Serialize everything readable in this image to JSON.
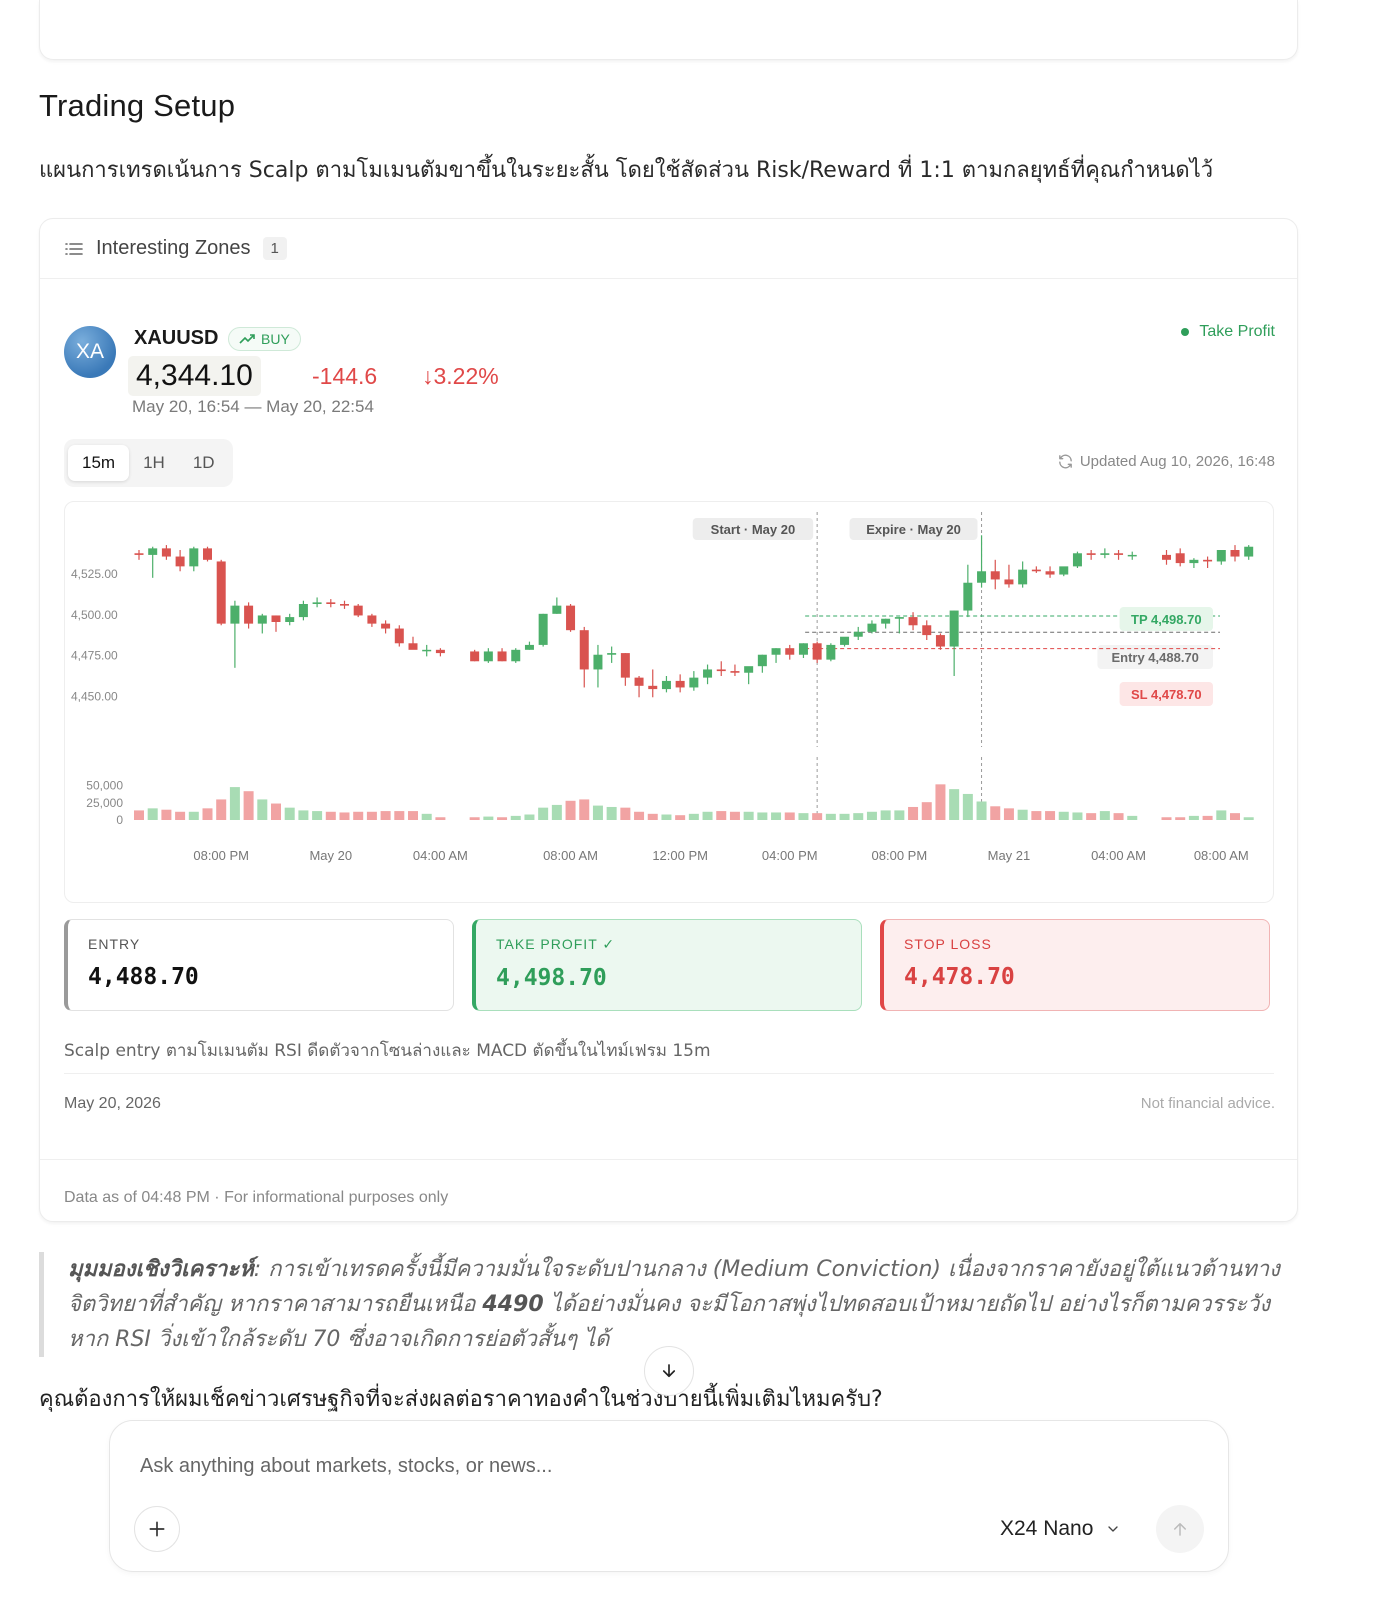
{
  "setup": {
    "title": "Trading Setup",
    "description": "แผนการเทรดเน้นการ Scalp ตามโมเมนตัมขาขึ้นในระยะสั้น โดยใช้สัดส่วน Risk/Reward ที่ 1:1 ตามกลยุทธ์ที่คุณกำหนดไว้"
  },
  "zones": {
    "title": "Interesting Zones",
    "count": "1"
  },
  "signal": {
    "avatar": "XA",
    "symbol": "XAUUSD",
    "direction": "BUY",
    "price": "4,344.10",
    "change": "-144.6",
    "change_pct": "3.22%",
    "time_range": "May 20, 16:54 — May 20, 22:54",
    "status": "Take Profit",
    "timeframes": [
      "15m",
      "1H",
      "1D"
    ],
    "active_timeframe": "15m",
    "updated": "Updated Aug 10, 2026, 16:48",
    "levels": {
      "entry_label": "ENTRY",
      "entry": "4,488.70",
      "tp_label": "TAKE PROFIT ✓",
      "tp": "4,498.70",
      "sl_label": "STOP LOSS",
      "sl": "4,478.70"
    },
    "rationale": "Scalp entry ตามโมเมนตัม RSI ดีดตัวจากโซนล่างและ MACD ตัดขึ้นในไทม์เฟรม 15m",
    "date": "May 20, 2026",
    "disclaimer": "Not financial advice.",
    "data_note": "Data as of 04:48 PM · For informational purposes only"
  },
  "chart_data": {
    "type": "candlestick",
    "y_ticks": [
      "4,525.00",
      "4,500.00",
      "4,475.00",
      "4,450.00"
    ],
    "ylim": [
      4440,
      4550
    ],
    "volume_ticks": [
      "50,000",
      "25,000",
      "0"
    ],
    "volume_lim": [
      0,
      70000
    ],
    "x_ticks": [
      {
        "i": 6,
        "label": "08:00 PM"
      },
      {
        "i": 14,
        "label": "May 20"
      },
      {
        "i": 22,
        "label": "04:00 AM"
      },
      {
        "i": 30,
        "label": "08:00 AM"
      },
      {
        "i": 38,
        "label": "12:00 PM"
      },
      {
        "i": 46,
        "label": "04:00 PM"
      },
      {
        "i": 54,
        "label": "08:00 PM"
      },
      {
        "i": 62,
        "label": "May 21"
      },
      {
        "i": 70,
        "label": "04:00 AM"
      },
      {
        "i": 76,
        "label": "08:00 AM"
      }
    ],
    "markers": [
      {
        "i": 48,
        "label": "Start · May 20"
      },
      {
        "i": 60,
        "label": "Expire · May 20"
      }
    ],
    "levels": [
      {
        "label": "TP 4,498.70",
        "value": 4498.7,
        "color": "#34a864"
      },
      {
        "label": "Entry 4,488.70",
        "value": 4488.7,
        "color": "#6b6b6b"
      },
      {
        "label": "SL 4,478.70",
        "value": 4478.7,
        "color": "#e04848"
      }
    ],
    "candles": [
      [
        4537,
        4539,
        4533,
        4536,
        14000
      ],
      [
        4536,
        4541,
        4522,
        4540,
        17000
      ],
      [
        4540,
        4542,
        4533,
        4535,
        15000
      ],
      [
        4535,
        4539,
        4526,
        4529,
        12000
      ],
      [
        4529,
        4541,
        4526,
        4540,
        12000
      ],
      [
        4540,
        4541,
        4532,
        4533,
        17000
      ],
      [
        4532,
        4533,
        4493,
        4494,
        30000
      ],
      [
        4494,
        4508,
        4467,
        4505,
        48000
      ],
      [
        4505,
        4507,
        4491,
        4494,
        42000
      ],
      [
        4494,
        4500,
        4488,
        4499,
        30000
      ],
      [
        4499,
        4499,
        4489,
        4495,
        24000
      ],
      [
        4495,
        4500,
        4493,
        4498,
        18000
      ],
      [
        4498,
        4508,
        4496,
        4506,
        14000
      ],
      [
        4506,
        4510,
        4504,
        4507,
        13000
      ],
      [
        4507,
        4509,
        4504,
        4506,
        12000
      ],
      [
        4506,
        4508,
        4503,
        4505,
        11000
      ],
      [
        4505,
        4506,
        4498,
        4499,
        12000
      ],
      [
        4499,
        4500,
        4492,
        4494,
        12000
      ],
      [
        4494,
        4496,
        4488,
        4491,
        13000
      ],
      [
        4491,
        4493,
        4480,
        4482,
        13000
      ],
      [
        4482,
        4486,
        4479,
        4478,
        13000
      ],
      [
        4478,
        4481,
        4474,
        4478,
        9000
      ],
      [
        4478,
        4479,
        4474,
        4476,
        4000
      ],
      [
        4477,
        4478,
        4471,
        4471,
        4000
      ],
      [
        4471,
        4479,
        4470,
        4477,
        5000
      ],
      [
        4477,
        4479,
        4471,
        4471,
        4000
      ],
      [
        4471,
        4479,
        4470,
        4478,
        6000
      ],
      [
        4478,
        4483,
        4478,
        4481,
        8000
      ],
      [
        4481,
        4500,
        4480,
        4500,
        18000
      ],
      [
        4500,
        4510,
        4500,
        4505,
        22000
      ],
      [
        4505,
        4506,
        4489,
        4490,
        28000
      ],
      [
        4490,
        4492,
        4455,
        4466,
        30000
      ],
      [
        4466,
        4481,
        4455,
        4475,
        21000
      ],
      [
        4475,
        4480,
        4470,
        4476,
        19000
      ],
      [
        4476,
        4476,
        4456,
        4461,
        18000
      ],
      [
        4461,
        4462,
        4449,
        4456,
        12000
      ],
      [
        4456,
        4466,
        4449,
        4454,
        9000
      ],
      [
        4454,
        4462,
        4452,
        4459,
        8000
      ],
      [
        4459,
        4463,
        4452,
        4455,
        7000
      ],
      [
        4455,
        4465,
        4453,
        4461,
        9000
      ],
      [
        4461,
        4469,
        4457,
        4466,
        12000
      ],
      [
        4466,
        4471,
        4462,
        4465,
        13000
      ],
      [
        4465,
        4469,
        4462,
        4464,
        12000
      ],
      [
        4464,
        4465,
        4457,
        4468,
        12000
      ],
      [
        4468,
        4475,
        4464,
        4475,
        11000
      ],
      [
        4475,
        4479,
        4470,
        4479,
        11000
      ],
      [
        4479,
        4481,
        4472,
        4475,
        11000
      ],
      [
        4475,
        4482,
        4473,
        4482,
        10000
      ],
      [
        4482,
        4483,
        4470,
        4472,
        10000
      ],
      [
        4472,
        4482,
        4471,
        4481,
        9000
      ],
      [
        4481,
        4483,
        4480,
        4486,
        9000
      ],
      [
        4486,
        4492,
        4484,
        4489,
        10000
      ],
      [
        4489,
        4496,
        4488,
        4494,
        12000
      ],
      [
        4494,
        4497,
        4491,
        4497,
        14000
      ],
      [
        4497,
        4498,
        4488,
        4498,
        14000
      ],
      [
        4498,
        4501,
        4490,
        4493,
        19000
      ],
      [
        4493,
        4496,
        4484,
        4487,
        26000
      ],
      [
        4487,
        4488,
        4478,
        4480,
        52000
      ],
      [
        4480,
        4502,
        4462,
        4502,
        45000
      ],
      [
        4502,
        4530,
        4498,
        4519,
        38000
      ],
      [
        4519,
        4548,
        4516,
        4526,
        27000
      ],
      [
        4526,
        4533,
        4515,
        4521,
        20000
      ],
      [
        4521,
        4530,
        4516,
        4518,
        17000
      ],
      [
        4518,
        4532,
        4516,
        4527,
        15000
      ],
      [
        4527,
        4529,
        4525,
        4526,
        13000
      ],
      [
        4526,
        4529,
        4522,
        4524,
        13000
      ],
      [
        4524,
        4528,
        4523,
        4529,
        12000
      ],
      [
        4529,
        4538,
        4528,
        4537,
        11000
      ],
      [
        4537,
        4539,
        4533,
        4536,
        10000
      ],
      [
        4536,
        4540,
        4534,
        4537,
        13000
      ],
      [
        4537,
        4539,
        4533,
        4536,
        10000
      ],
      [
        4536,
        4538,
        4533,
        4536,
        6000
      ],
      [
        4536,
        4539,
        4530,
        4533,
        4000
      ],
      [
        4537,
        4540,
        4529,
        4531,
        4000
      ],
      [
        4531,
        4534,
        4528,
        4533,
        6000
      ],
      [
        4533,
        4535,
        4528,
        4532,
        6000
      ],
      [
        4532,
        4539,
        4530,
        4539,
        14000
      ],
      [
        4539,
        4542,
        4532,
        4535,
        10000
      ],
      [
        4535,
        4542,
        4533,
        4541,
        4000
      ]
    ],
    "gaps_after": [
      22,
      71
    ]
  },
  "analysis": {
    "label": "มุมมองเชิงวิเคราะห์",
    "text_before": ": การเข้าเทรดครั้งนี้มีความมั่นใจระดับปานกลาง (Medium Conviction) เนื่องจากราคายังอยู่ใต้แนวต้านทางจิตวิทยาที่สำคัญ หากราคาสามารถยืนเหนือ ",
    "bold_value": "4490",
    "text_after": " ได้อย่างมั่นคง จะมีโอกาสพุ่งไปทดสอบเป้าหมายถัดไป อย่างไรก็ตามควรระวังหาก RSI วิ่งเข้าใกล้ระดับ 70 ซึ่งอาจเกิดการย่อตัวสั้นๆ ได้"
  },
  "question": "คุณต้องการให้ผมเช็คข่าวเศรษฐกิจที่จะส่งผลต่อราคาทองคำในช่วงบ่ายนี้เพิ่มเติมไหมครับ?",
  "composer": {
    "placeholder": "Ask anything about markets, stocks, or news...",
    "model": "X24 Nano"
  },
  "colors": {
    "up": "#4caf6a",
    "down": "#d9534f",
    "up_volume": "#a8dcb4",
    "down_volume": "#f1a3a3"
  }
}
